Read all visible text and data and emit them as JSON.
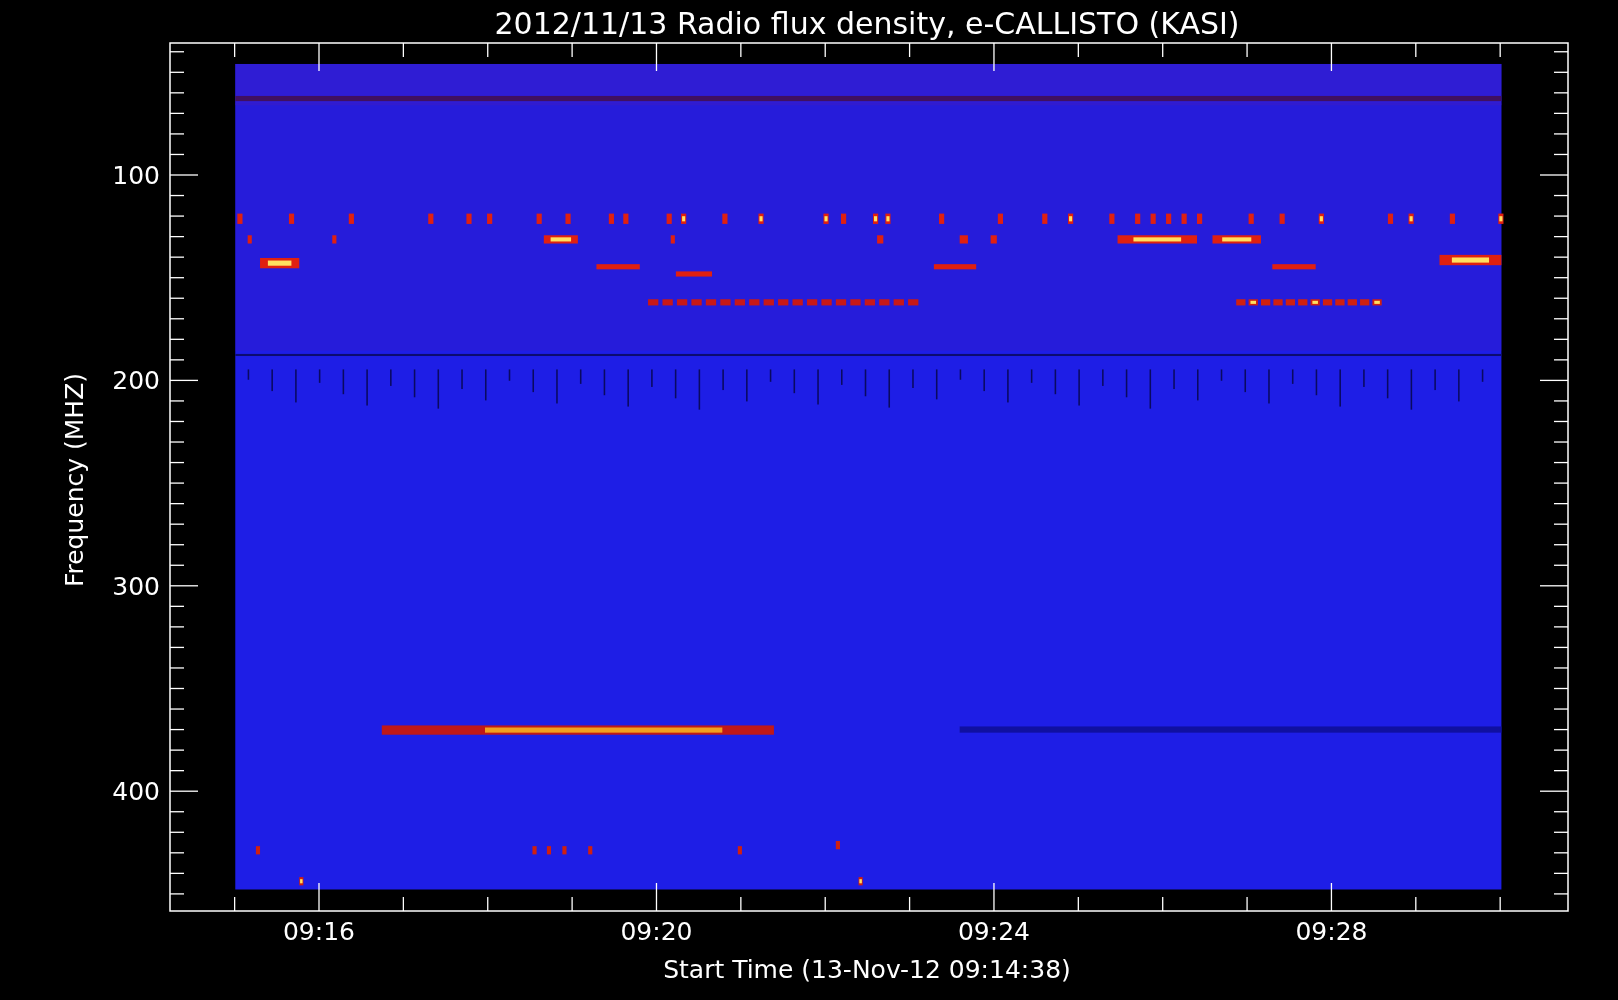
{
  "title": "2012/11/13  Radio flux density, e-CALLISTO (KASI)",
  "y_axis": {
    "label": "Frequency (MHZ)",
    "tick_labels": [
      "100",
      "200",
      "300",
      "400"
    ]
  },
  "x_axis": {
    "label": "Start Time (13-Nov-12 09:14:38)",
    "tick_labels": [
      "09:16",
      "09:20",
      "09:24",
      "09:28"
    ]
  }
}
